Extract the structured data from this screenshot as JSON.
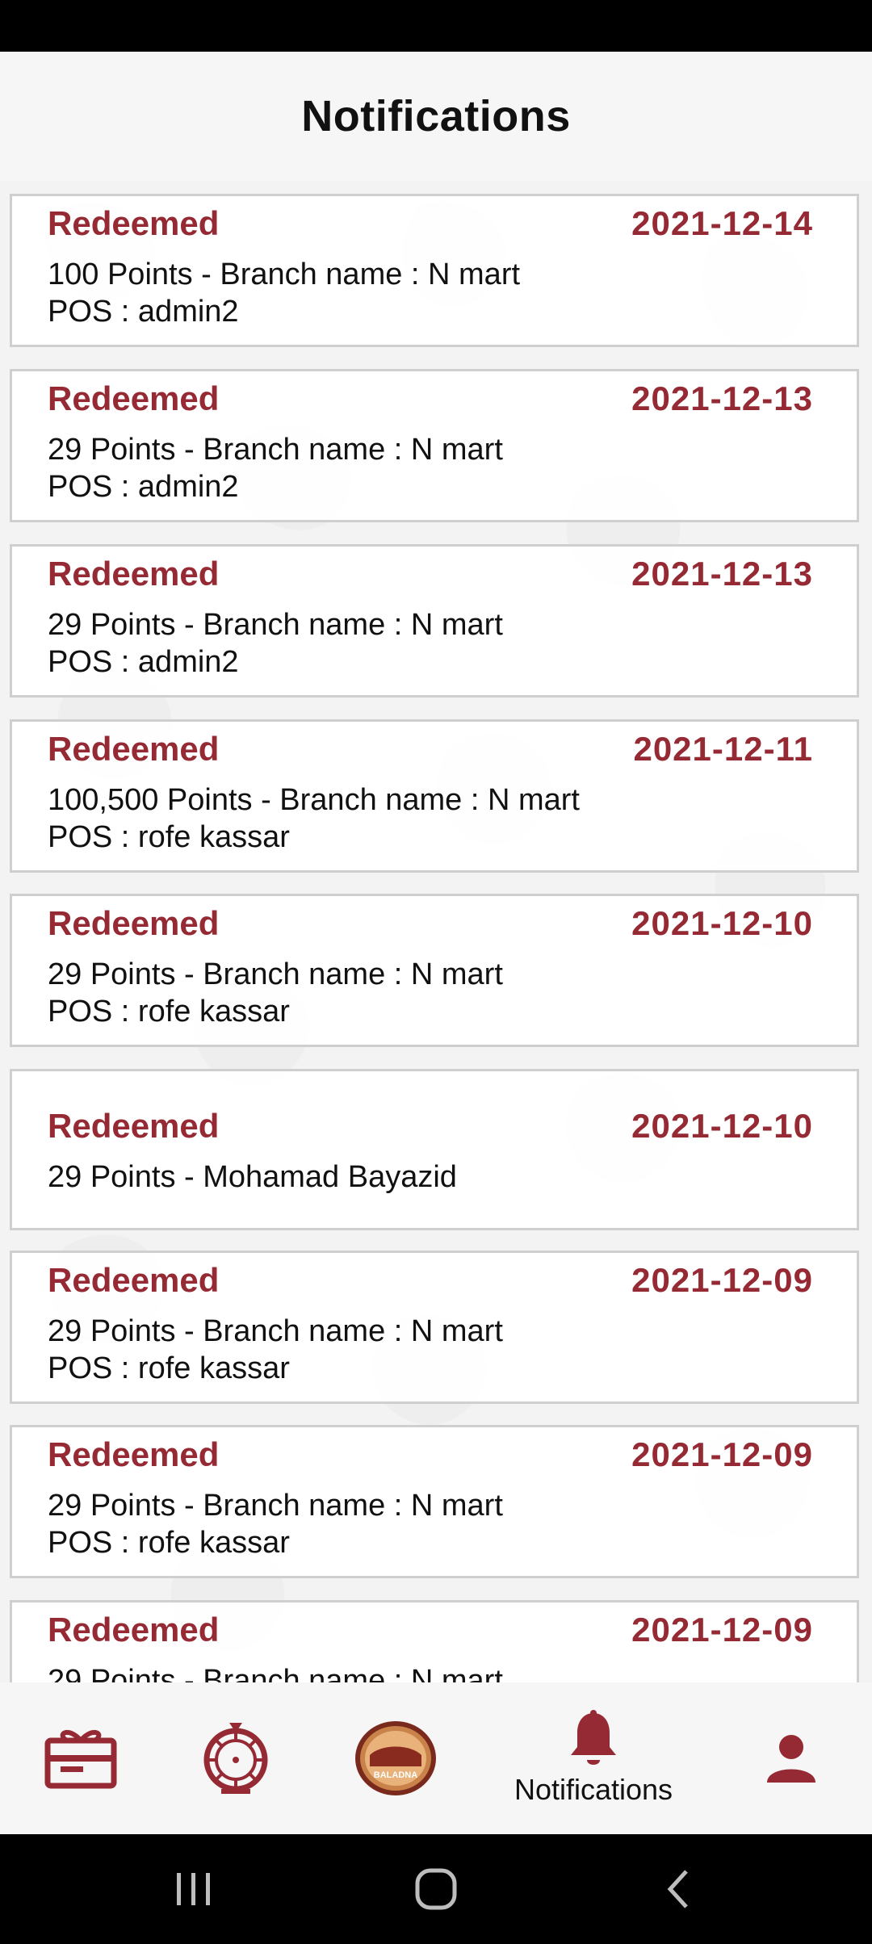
{
  "header": {
    "title": "Notifications"
  },
  "notifications": [
    {
      "type": "Redeemed",
      "date": "2021-12-14",
      "line1": "100 Points - Branch name : N mart",
      "line2": "POS : admin2"
    },
    {
      "type": "Redeemed",
      "date": "2021-12-13",
      "line1": "29 Points - Branch name : N mart",
      "line2": "POS : admin2"
    },
    {
      "type": "Redeemed",
      "date": "2021-12-13",
      "line1": "29 Points - Branch name : N mart",
      "line2": "POS : admin2"
    },
    {
      "type": "Redeemed",
      "date": "2021-12-11",
      "line1": "100,500 Points - Branch name : N mart",
      "line2": "POS : rofe kassar"
    },
    {
      "type": "Redeemed",
      "date": "2021-12-10",
      "line1": "29 Points - Branch name : N mart",
      "line2": "POS : rofe kassar"
    },
    {
      "type": "Redeemed",
      "date": "2021-12-10",
      "line1": "29 Points - Mohamad Bayazid",
      "line2": ""
    },
    {
      "type": "Redeemed",
      "date": "2021-12-09",
      "line1": "29 Points - Branch name : N mart",
      "line2": "POS : rofe kassar"
    },
    {
      "type": "Redeemed",
      "date": "2021-12-09",
      "line1": "29 Points - Branch name : N mart",
      "line2": "POS : rofe kassar"
    },
    {
      "type": "Redeemed",
      "date": "2021-12-09",
      "line1": "29 Points - Branch name : N mart",
      "line2": ""
    }
  ],
  "bottom_nav": {
    "items": [
      {
        "icon": "gift-card-icon",
        "label": ""
      },
      {
        "icon": "spin-wheel-icon",
        "label": ""
      },
      {
        "icon": "baladna-logo",
        "label": "",
        "logo_text": "BALADNA"
      },
      {
        "icon": "bell-icon",
        "label": "Notifications"
      },
      {
        "icon": "profile-icon",
        "label": ""
      }
    ]
  },
  "colors": {
    "accent": "#962a34",
    "background": "#f6f6f6"
  }
}
